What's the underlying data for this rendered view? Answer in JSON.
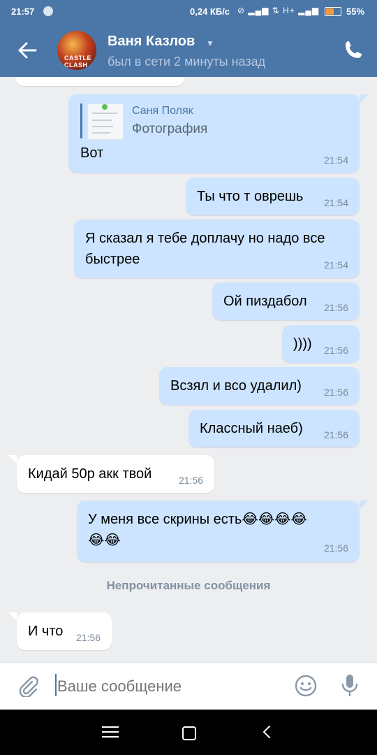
{
  "status_bar": {
    "time": "21:57",
    "speed": "0,24 КБ/с",
    "network": "H+",
    "battery": "55%",
    "battery_level": 0.55
  },
  "header": {
    "contact_name": "Ваня Казлов",
    "last_seen": "был в сети 2 минуты назад",
    "avatar_text": "CASTLE CLASH"
  },
  "forward": {
    "author": "Саня Поляк",
    "type": "Фотография"
  },
  "messages": [
    {
      "text": "Вот",
      "time": "21:54"
    },
    {
      "text": "Ты что т оврешь",
      "time": "21:54"
    },
    {
      "text": "Я сказал я тебе доплачу но надо все\nбыстрее",
      "time": "21:54"
    },
    {
      "text": "Ой пиздабол",
      "time": "21:56"
    },
    {
      "text": "))))",
      "time": "21:56"
    },
    {
      "text": "Всзял и всо удалил)",
      "time": "21:56"
    },
    {
      "text": "Классный наеб)",
      "time": "21:56"
    },
    {
      "text": "Кидай 50р акк твой",
      "time": "21:56"
    },
    {
      "text": "У меня все скрины есть😂😂😂😂\n😂😂",
      "time": "21:56"
    },
    {
      "text": "И что",
      "time": "21:56"
    }
  ],
  "unread_divider": "Непрочитанные сообщения",
  "composer": {
    "placeholder": "Ваше сообщение"
  },
  "colors": {
    "header": "#4a76a8",
    "outgoing_bubble": "#cce4ff",
    "incoming_bubble": "#ffffff",
    "background": "#edeef0"
  }
}
